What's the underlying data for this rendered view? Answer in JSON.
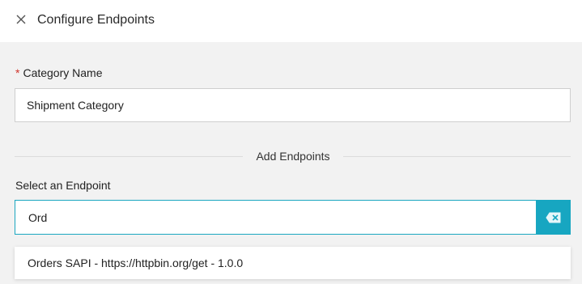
{
  "header": {
    "title": "Configure Endpoints",
    "close_icon": "close-icon"
  },
  "category": {
    "required_marker": "*",
    "label": "Category Name",
    "value": "Shipment Category"
  },
  "divider": {
    "label": "Add Endpoints"
  },
  "endpoint": {
    "label": "Select an Endpoint",
    "search_value": "Ord",
    "clear_icon": "clear-input-icon",
    "options": [
      "Orders SAPI - https://httpbin.org/get - 1.0.0"
    ]
  },
  "colors": {
    "accent": "#17a6c1",
    "required": "#d0342c"
  }
}
